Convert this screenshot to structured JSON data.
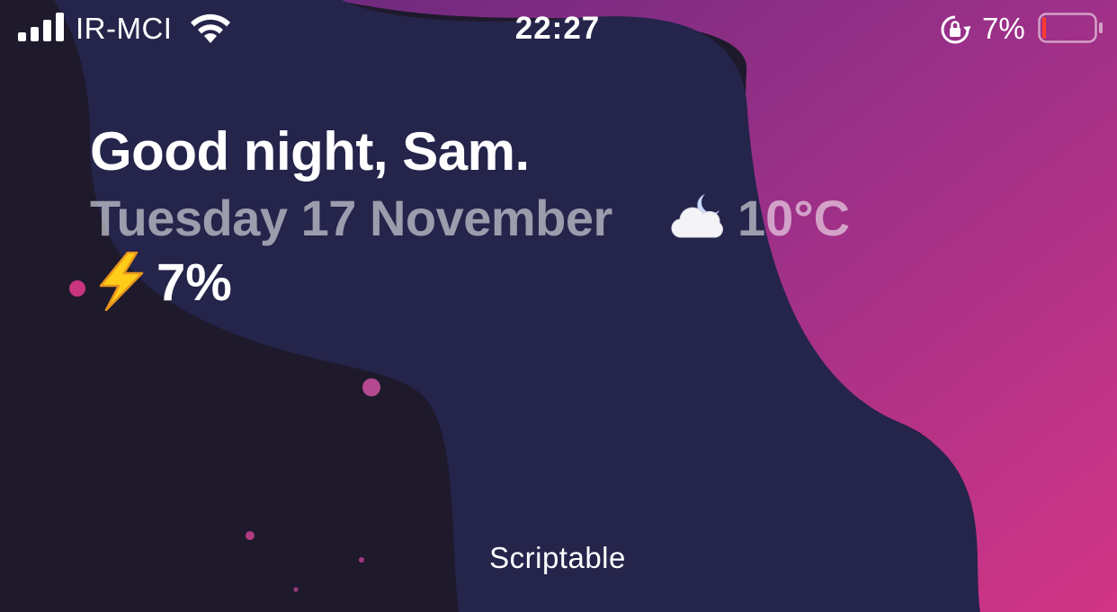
{
  "status_bar": {
    "carrier": "IR-MCI",
    "time": "22:27",
    "battery_percent": "7%",
    "battery_level": 0.07,
    "icons": [
      "signal-icon",
      "wifi-icon",
      "rotation-lock-icon",
      "battery-icon"
    ]
  },
  "widget": {
    "greeting": "Good night, Sam.",
    "date": "Tuesday 17 November",
    "weather_icon": "cloud-moon-icon",
    "temperature": "10°C",
    "battery_icon": "lightning-bolt-icon",
    "battery_value": "7%",
    "caption": "Scriptable"
  },
  "colors": {
    "dark_blob": "#1e1a2c",
    "navy_blob": "#25244b",
    "purple_top": "#7b2d83",
    "pink_bottom": "#cb3584",
    "dot_pink": "#c8347f",
    "battery_low": "#ff3b30"
  }
}
